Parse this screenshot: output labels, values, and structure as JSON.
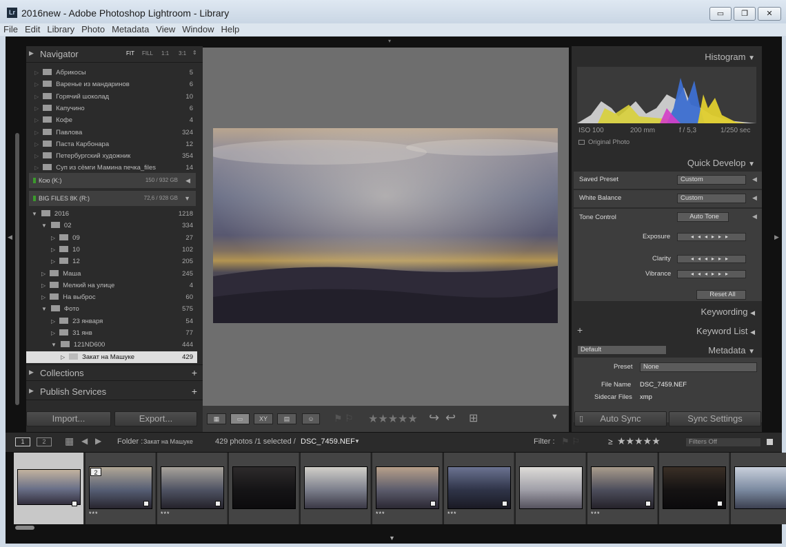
{
  "window": {
    "title": "2016new - Adobe Photoshop Lightroom - Library",
    "logo": "Lr",
    "minimize": "▭",
    "maximize": "❐",
    "close": "✕"
  },
  "menu": [
    "File",
    "Edit",
    "Library",
    "Photo",
    "Metadata",
    "View",
    "Window",
    "Help"
  ],
  "navigator": {
    "title": "Navigator",
    "fit": "FIT",
    "fill": "FILL",
    "one": "1:1",
    "three": "3:1"
  },
  "folders_top": [
    {
      "name": "Абрикосы",
      "count": "5"
    },
    {
      "name": "Варенье из мандаринов",
      "count": "6"
    },
    {
      "name": "Горячий шоколад",
      "count": "10"
    },
    {
      "name": "Капучино",
      "count": "6"
    },
    {
      "name": "Кофе",
      "count": "4"
    },
    {
      "name": "Павлова",
      "count": "324"
    },
    {
      "name": "Паста Карбонара",
      "count": "12"
    },
    {
      "name": "Петербургский художник",
      "count": "354"
    },
    {
      "name": "Суп из сёмги    Мамина печка_files",
      "count": "14"
    }
  ],
  "volumes": [
    {
      "name": "Кcю (K:)",
      "size": "150 / 932 GB"
    },
    {
      "name": "BIG FILES 8K (R:)",
      "size": "72,6 / 928 GB"
    }
  ],
  "folders_tree": [
    {
      "name": "2016",
      "count": "1218",
      "level": 0,
      "arrow": "▼"
    },
    {
      "name": "02",
      "count": "334",
      "level": 1,
      "arrow": "▼"
    },
    {
      "name": "09",
      "count": "27",
      "level": 2,
      "arrow": "▷"
    },
    {
      "name": "10",
      "count": "102",
      "level": 2,
      "arrow": "▷"
    },
    {
      "name": "12",
      "count": "205",
      "level": 2,
      "arrow": "▷"
    },
    {
      "name": "Маша",
      "count": "245",
      "level": 1,
      "arrow": "▷"
    },
    {
      "name": "Мелкий на улице",
      "count": "4",
      "level": 1,
      "arrow": "▷"
    },
    {
      "name": "На выброс",
      "count": "60",
      "level": 1,
      "arrow": "▷"
    },
    {
      "name": "Фото",
      "count": "575",
      "level": 1,
      "arrow": "▼"
    },
    {
      "name": "23 января",
      "count": "54",
      "level": 2,
      "arrow": "▷"
    },
    {
      "name": "31 янв",
      "count": "77",
      "level": 2,
      "arrow": "▷"
    },
    {
      "name": "121ND600",
      "count": "444",
      "level": 2,
      "arrow": "▼"
    },
    {
      "name": "Закат на Машуке",
      "count": "429",
      "level": 3,
      "arrow": "▷",
      "selected": true
    }
  ],
  "collections": "Collections",
  "publish": "Publish Services",
  "import": "Import...",
  "export": "Export...",
  "histogram": {
    "title": "Histogram",
    "iso": "ISO 100",
    "focal": "200 mm",
    "aperture": "f / 5,3",
    "shutter": "1/250 sec",
    "original": "Original Photo"
  },
  "quick_develop": {
    "title": "Quick Develop",
    "saved_preset": "Saved Preset",
    "saved_preset_val": "Custom",
    "white_balance": "White Balance",
    "white_balance_val": "Custom",
    "tone_control": "Tone Control",
    "auto_tone": "Auto Tone",
    "exposure": "Exposure",
    "clarity": "Clarity",
    "vibrance": "Vibrance",
    "reset_all": "Reset All"
  },
  "keywording": "Keywording",
  "keyword_list": "Keyword List",
  "plus": "+",
  "metadata": {
    "title": "Metadata",
    "default": "Default",
    "preset_label": "Preset",
    "preset_val": "None",
    "filename_label": "File Name",
    "filename_val": "DSC_7459.NEF",
    "sidecar_label": "Sidecar Files",
    "sidecar_val": "xmp"
  },
  "auto_sync": "Auto Sync",
  "sync_settings": "Sync Settings",
  "filmbar": {
    "one": "1",
    "two": "2",
    "folder_label": "Folder : ",
    "folder_name": "Закат на Машуке",
    "count": "429 photos /1 selected /",
    "file": "DSC_7459.NEF",
    "filter_label": "Filter :",
    "filters_off": "Filters Off",
    "ge": "≥"
  },
  "thumbs": [
    {
      "stars": "",
      "badge": "",
      "sel": true
    },
    {
      "stars": "***",
      "badge": "2"
    },
    {
      "stars": "***",
      "badge": ""
    },
    {
      "stars": "",
      "badge": ""
    },
    {
      "stars": "",
      "badge": ""
    },
    {
      "stars": "***",
      "badge": ""
    },
    {
      "stars": "***",
      "badge": ""
    },
    {
      "stars": "",
      "badge": ""
    },
    {
      "stars": "***",
      "badge": ""
    },
    {
      "stars": "",
      "badge": ""
    },
    {
      "stars": "",
      "badge": ""
    }
  ],
  "toolbar": {
    "rating": "★★★★★",
    "xy": "XY"
  },
  "colors": {
    "bg": "#2b2b2b",
    "center": "#6e6e6e",
    "selected": "#dedede"
  }
}
